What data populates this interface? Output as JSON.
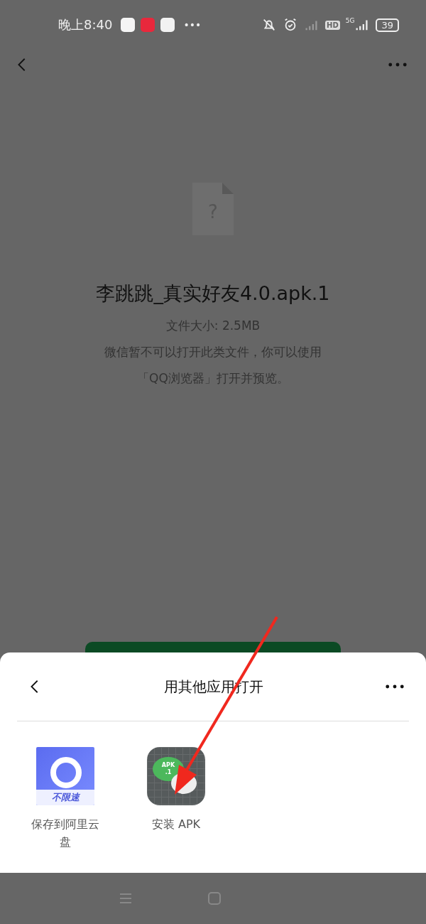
{
  "status_bar": {
    "time": "晚上8:40",
    "more": "•••",
    "network": "5G",
    "hd": "HD",
    "battery": "39"
  },
  "file": {
    "icon_glyph": "?",
    "name": "李跳跳_真实好友4.0.apk.1",
    "size": "文件大小: 2.5MB",
    "notice": "微信暂不可以打开此类文件，你可以使用",
    "notice_2": "「QQ浏览器」打开并预览。"
  },
  "sheet": {
    "title": "用其他应用打开",
    "apps": [
      {
        "kind": "cloud",
        "label": "保存到阿里云盘",
        "icon_text": [
          "不限速"
        ]
      },
      {
        "kind": "apk",
        "label": "安装 APK",
        "icon_text": [
          "APK",
          ".1"
        ]
      }
    ]
  }
}
